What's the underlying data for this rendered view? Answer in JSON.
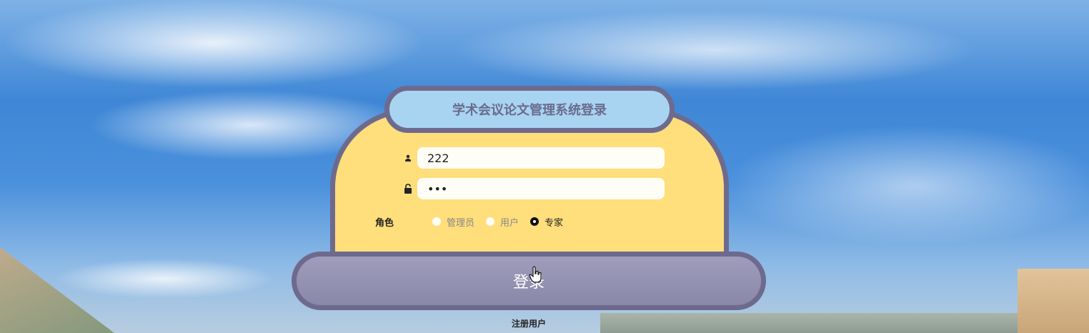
{
  "title": "学术会议论文管理系统登录",
  "username": {
    "value": "222",
    "icon": "user-icon"
  },
  "password": {
    "value": "•••",
    "icon": "lock-icon"
  },
  "role": {
    "label": "角色",
    "options": [
      "管理员",
      "用户",
      "专家"
    ],
    "selected": "专家"
  },
  "login_label": "登录",
  "register_label": "注册用户",
  "colors": {
    "card": "#ffde7c",
    "border": "#6e6a8e",
    "title_bg": "#a8d4f2",
    "button": "#9f9cbc"
  }
}
